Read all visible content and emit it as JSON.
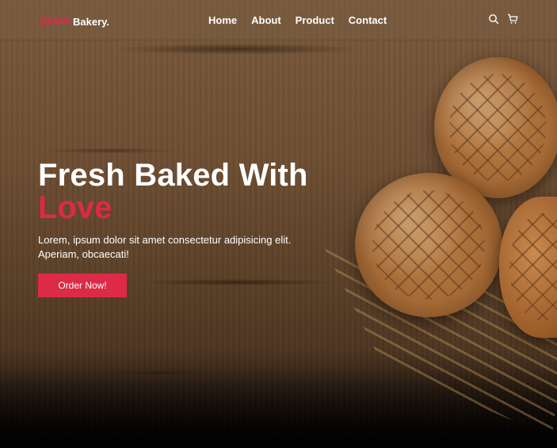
{
  "brand": {
    "logo_text": "Bakery.",
    "accent_color": "#dc2a47"
  },
  "nav": {
    "links": [
      {
        "label": "Home"
      },
      {
        "label": "About"
      },
      {
        "label": "Product"
      },
      {
        "label": "Contact"
      }
    ],
    "icons": [
      "search-icon",
      "cart-icon"
    ]
  },
  "hero": {
    "title_line1": "Fresh Baked With",
    "title_line2": "Love",
    "description": "Lorem, ipsum dolor sit amet consectetur adipisicing elit. Aperiam, obcaecati!",
    "cta_label": "Order Now!"
  }
}
